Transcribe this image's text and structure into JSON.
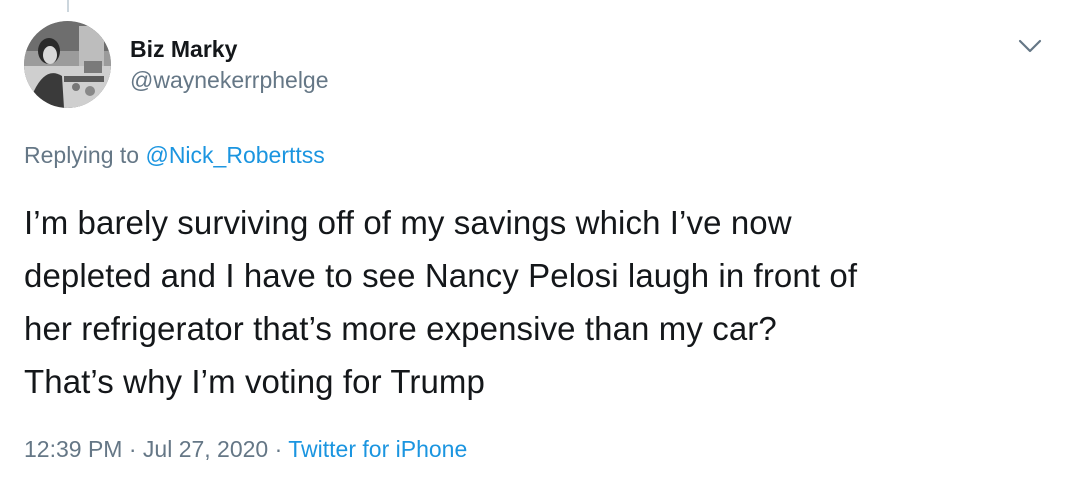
{
  "author": {
    "display_name": "Biz Marky",
    "handle": "@waynekerrphelge"
  },
  "reply": {
    "prefix": "Replying to",
    "mention": "@Nick_Roberttss"
  },
  "tweet": {
    "lines": [
      "I’m barely surviving off of my savings which I’ve now",
      "depleted and I have to see Nancy Pelosi laugh in front of",
      "her refrigerator that’s more expensive than my car?",
      "That’s why I’m voting for Trump"
    ]
  },
  "meta": {
    "time": "12:39 PM",
    "separator": "·",
    "date": "Jul 27, 2020",
    "source": "Twitter for iPhone"
  },
  "icons": {
    "menu": "chevron-down-icon",
    "avatar": "avatar-photo"
  },
  "colors": {
    "text": "#14171a",
    "secondary": "#657786",
    "link": "#1b95e0"
  }
}
